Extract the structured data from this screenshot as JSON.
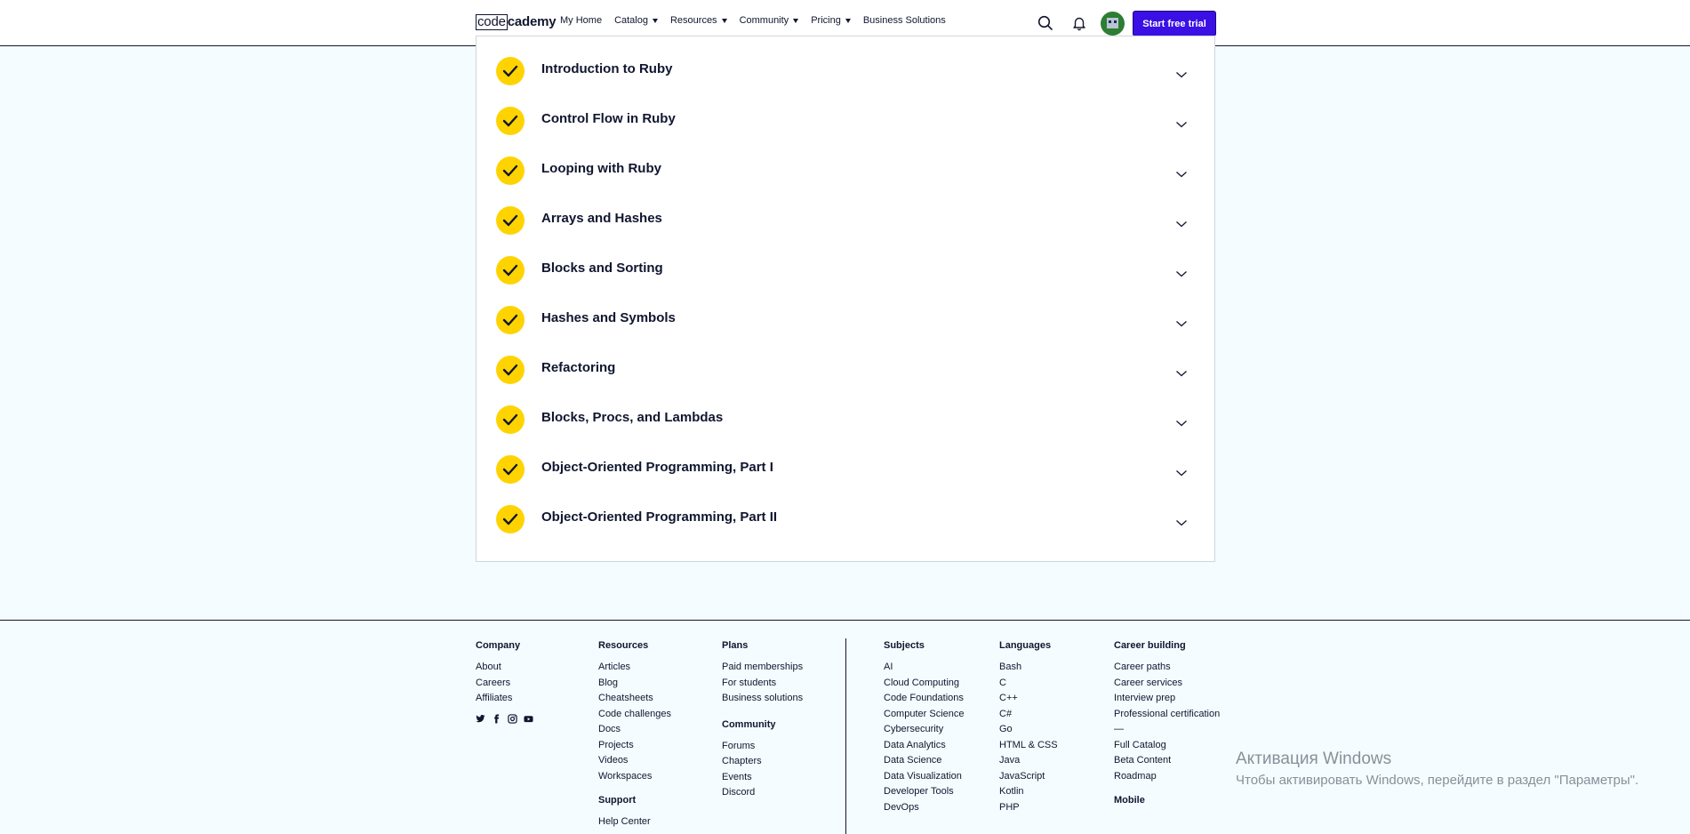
{
  "header": {
    "logo_left": "code",
    "logo_right": "cademy",
    "nav": [
      {
        "label": "My Home",
        "caret": false
      },
      {
        "label": "Catalog",
        "caret": true
      },
      {
        "label": "Resources",
        "caret": true
      },
      {
        "label": "Community",
        "caret": true
      },
      {
        "label": "Pricing",
        "caret": true
      },
      {
        "label": "Business Solutions",
        "caret": false
      }
    ],
    "icons": [
      "search-icon",
      "bell-icon",
      "avatar"
    ],
    "cta": "Start free trial",
    "accent": "#3a10e5"
  },
  "syllabus": {
    "check_color": "#ffd300",
    "modules": [
      "Introduction to Ruby",
      "Control Flow in Ruby",
      "Looping with Ruby",
      "Arrays and Hashes",
      "Blocks and Sorting",
      "Hashes and Symbols",
      "Refactoring",
      "Blocks, Procs, and Lambdas",
      "Object-Oriented Programming, Part I",
      "Object-Oriented Programming, Part II"
    ]
  },
  "footer": {
    "company": {
      "title": "Company",
      "links": [
        "About",
        "Careers",
        "Affiliates"
      ]
    },
    "resources": {
      "title": "Resources",
      "links": [
        "Articles",
        "Blog",
        "Cheatsheets",
        "Code challenges",
        "Docs",
        "Projects",
        "Videos",
        "Workspaces"
      ]
    },
    "support": {
      "title": "Support",
      "links": [
        "Help Center"
      ]
    },
    "plans": {
      "title": "Plans",
      "links": [
        "Paid memberships",
        "For students",
        "Business solutions"
      ]
    },
    "community": {
      "title": "Community",
      "links": [
        "Forums",
        "Chapters",
        "Events",
        "Discord"
      ]
    },
    "subjects": {
      "title": "Subjects",
      "links": [
        "AI",
        "Cloud Computing",
        "Code Foundations",
        "Computer Science",
        "Cybersecurity",
        "Data Analytics",
        "Data Science",
        "Data Visualization",
        "Developer Tools",
        "DevOps"
      ]
    },
    "languages": {
      "title": "Languages",
      "links": [
        "Bash",
        "C",
        "C++",
        "C#",
        "Go",
        "HTML & CSS",
        "Java",
        "JavaScript",
        "Kotlin",
        "PHP"
      ]
    },
    "career": {
      "title": "Career building",
      "links": [
        "Career paths",
        "Career services",
        "Interview prep",
        "Professional certification",
        "—",
        "Full Catalog",
        "Beta Content",
        "Roadmap"
      ]
    },
    "mobile": {
      "title": "Mobile"
    },
    "social_icons": [
      "twitter-icon",
      "facebook-icon",
      "instagram-icon",
      "youtube-icon"
    ]
  },
  "watermark": {
    "line1": "Активация Windows",
    "line2": "Чтобы активировать Windows, перейдите в раздел \"Параметры\"."
  }
}
